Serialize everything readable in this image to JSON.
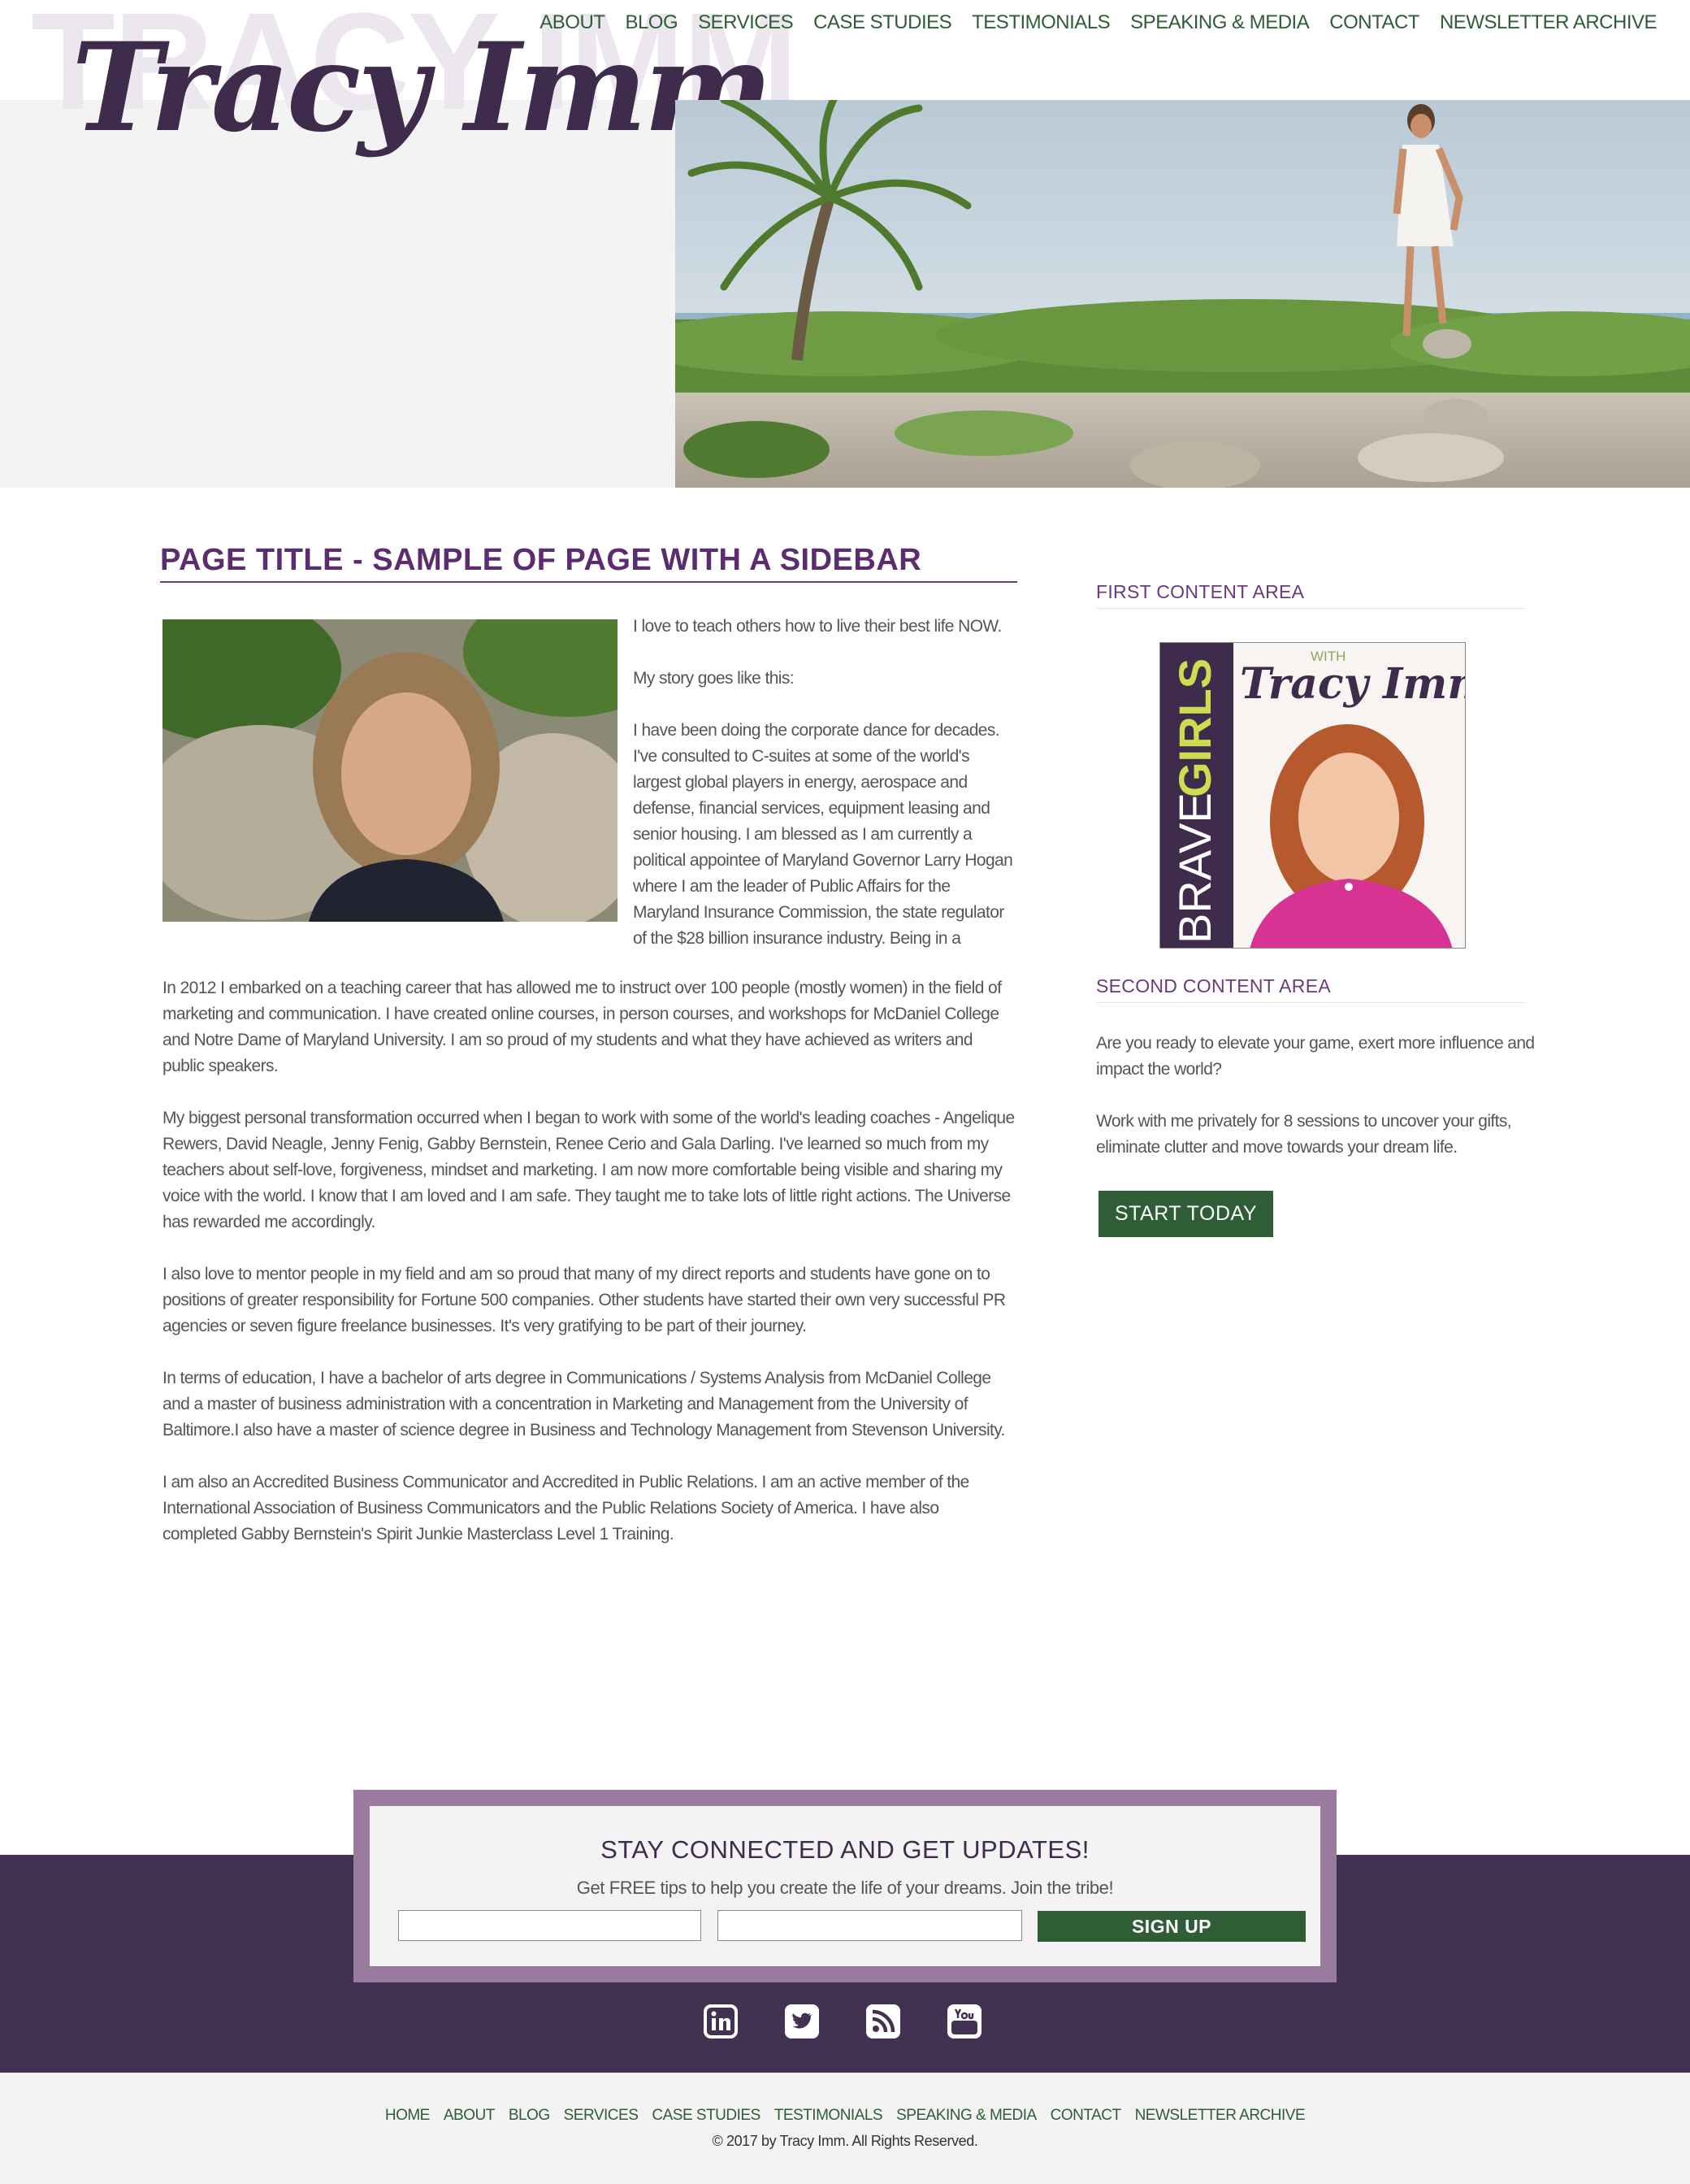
{
  "header": {
    "logo_ghost": "TRACY IMM",
    "logo": "Tracy Imm",
    "nav": [
      "ABOUT",
      "BLOG",
      "SERVICES",
      "CASE STUDIES",
      "TESTIMONIALS",
      "SPEAKING & MEDIA",
      "CONTACT",
      "NEWSLETTER ARCHIVE"
    ]
  },
  "main": {
    "title": "PAGE TITLE - SAMPLE OF PAGE WITH A SIDEBAR",
    "intro": [
      "I love to teach others how to live their best life NOW.",
      "My story goes like this:",
      "I have been doing the corporate dance for decades. I've consulted to C-suites at some of the world's largest global players in energy, aerospace and defense, financial services, equipment leasing and senior housing.  I am blessed as I am currently a political appointee of Maryland Governor Larry Hogan where I am the leader of Public Affairs for the Maryland Insurance Commission, the state regulator of the $28 billion insurance industry. Being in a"
    ],
    "paragraphs": [
      "In 2012 I embarked on a teaching career that has allowed me to instruct over 100 people (mostly women) in the field of marketing and communication. I have created online courses, in person courses, and workshops for McDaniel College and Notre Dame of Maryland University. I am so proud of my students and what they have achieved as writers and public speakers.",
      "My biggest personal transformation occurred when I began to work with some of the world's leading coaches - Angelique Rewers, David Neagle, Jenny Fenig, Gabby Bernstein, Renee Cerio and Gala Darling. I've learned so much from my teachers about self-love, forgiveness, mindset and marketing. I am now more comfortable being visible and sharing my voice with the world. I know that I am loved and I am safe. They taught me to take lots of little right actions. The Universe has rewarded me accordingly.",
      "I also love to mentor people in my field and am so proud that many of my direct reports and students have gone on to positions of greater responsibility for Fortune 500 companies. Other students have started their own very successful PR agencies or seven figure freelance businesses. It's very gratifying to be part of their journey.",
      "In terms of education, I have a bachelor of arts degree in Communications / Systems Analysis from McDaniel College and a master of business administration with a concentration in Marketing and Management from the University of Baltimore.I also have a master of science degree in Business and Technology Management from Stevenson University.",
      "I am also an Accredited Business Communicator and Accredited in Public Relations.  I am an active member of the International Association of Business Communicators and the Public Relations Society of America. I have also completed Gabby Bernstein's Spirit Junkie Masterclass Level 1 Training."
    ]
  },
  "sidebar": {
    "first_heading": "FIRST CONTENT AREA",
    "podcast": {
      "brave": "BRAVE",
      "girls": "GIRLS",
      "with": "WITH",
      "name": "Tracy Imm"
    },
    "second_heading": "SECOND CONTENT AREA",
    "texts": [
      "Are you ready to elevate your game, exert more influence and impact the world?",
      "Work with me privately for 8 sessions to uncover your gifts, eliminate clutter and move towards your dream life."
    ],
    "cta": "START TODAY"
  },
  "signup": {
    "title": "STAY CONNECTED AND GET UPDATES!",
    "subtitle": "Get FREE tips to help you create the life of your dreams. Join the tribe!",
    "field1": "",
    "field2": "",
    "button": "SIGN UP"
  },
  "social": [
    "linkedin-icon",
    "twitter-icon",
    "rss-icon",
    "youtube-icon"
  ],
  "footer": {
    "nav": [
      "HOME",
      "ABOUT",
      "BLOG",
      "SERVICES",
      "CASE STUDIES",
      "TESTIMONIALS",
      "SPEAKING & MEDIA",
      "CONTACT",
      "NEWSLETTER ARCHIVE"
    ],
    "copyright": "© 2017 by Tracy Imm. All Rights Reserved."
  },
  "colors": {
    "brand_purple": "#423150",
    "accent_green": "#2f5d35",
    "title_purple": "#5c2d6e",
    "frame_mauve": "#9a7b9f"
  }
}
